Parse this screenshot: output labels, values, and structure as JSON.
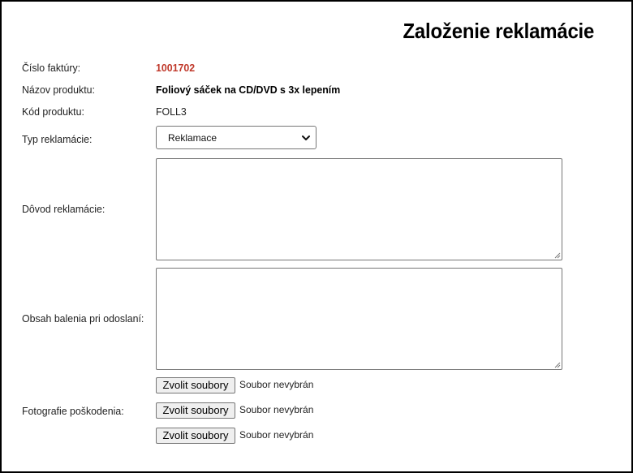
{
  "page": {
    "title": "Založenie reklamácie"
  },
  "fields": {
    "invoice_label": "Číslo faktúry:",
    "invoice_value": "1001702",
    "product_name_label": "Názov produktu:",
    "product_name_value": "Foliový sáček na CD/DVD s 3x lepením",
    "product_code_label": "Kód produktu:",
    "product_code_value": "FOLL3",
    "complaint_type_label": "Typ reklamácie:",
    "complaint_type_selected": "Reklamace",
    "reason_label": "Dôvod reklamácie:",
    "reason_value": "",
    "package_contents_label": "Obsah balenia pri odoslaní:",
    "package_contents_value": "",
    "photos_label": "Fotografie poškodenia:"
  },
  "file_inputs": [
    {
      "button_label": "Zvolit soubory",
      "status": "Soubor nevybrán"
    },
    {
      "button_label": "Zvolit soubory",
      "status": "Soubor nevybrán"
    },
    {
      "button_label": "Zvolit soubory",
      "status": "Soubor nevybrán"
    }
  ],
  "colors": {
    "invoice_accent": "#c0392b",
    "border": "#000000",
    "button_bg": "#efefef"
  },
  "icons": {
    "select_arrow": "chevron-down-icon",
    "resize_grip": "resize-grip-icon"
  }
}
